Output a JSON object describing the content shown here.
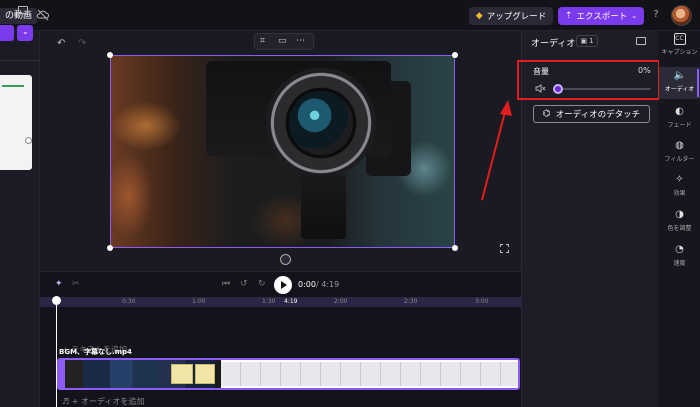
{
  "topbar": {
    "project_title_fragment": "の動画",
    "upgrade_label": "アップグレード",
    "export_label": "エクスポート",
    "help_label": "?"
  },
  "audio_panel": {
    "title": "オーディオ",
    "badge_count": "1",
    "volume_label": "音量",
    "volume_value": "0%",
    "volume_level": 0,
    "detach_label": "オーディオのデタッチ"
  },
  "right_toolbar": {
    "items": [
      {
        "label": "キャプション",
        "icon": "captions-icon",
        "active": false
      },
      {
        "label": "オーディオ",
        "icon": "speaker-icon",
        "active": true
      },
      {
        "label": "フェード",
        "icon": "fade-icon",
        "active": false
      },
      {
        "label": "フィルター",
        "icon": "filter-icon",
        "active": false
      },
      {
        "label": "効果",
        "icon": "magic-wand-icon",
        "active": false
      },
      {
        "label": "色を調整",
        "icon": "color-adjust-icon",
        "active": false
      },
      {
        "label": "速度",
        "icon": "speedometer-icon",
        "active": false
      }
    ]
  },
  "player": {
    "current_time": "0:00",
    "total_time": "/ 4:19"
  },
  "timeline": {
    "ticks": [
      "0:30",
      "1:00",
      "1:30",
      "2:00",
      "2:30",
      "3:00"
    ],
    "playhead_time": "4:19",
    "text_track_label": "+ テキストを追加",
    "video_track_label": "BGM、字幕なし.mp4",
    "audio_track_label": "♬ + オーディオを追加"
  },
  "colors": {
    "accent": "#7c3aed",
    "highlight_box": "#e21d1d",
    "background": "#16161f"
  }
}
